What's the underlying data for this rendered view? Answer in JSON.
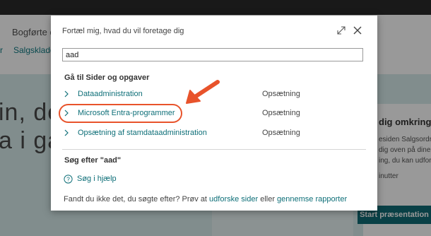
{
  "background": {
    "page_title_partial": "Bogførte do",
    "nav_partial": "Salgskladd",
    "nav_marker": "r",
    "hero_line1": "in, de",
    "hero_line2": "a i gar",
    "side_card": {
      "title": "dig omkring",
      "line1": "esiden Salgsordr",
      "line2": "dig oven på dine s",
      "line3": "ing, du kan udforsk",
      "line4": "inutter"
    },
    "start_button": "Start præsentation"
  },
  "dialog": {
    "title": "Fortæl mig, hvad du vil foretage dig",
    "search_value": "aad",
    "section_pages": "Gå til Sider og opgaver",
    "results": [
      {
        "label": "Dataadministration",
        "category": "Opsætning"
      },
      {
        "label": "Microsoft Entra-programmer",
        "category": "Opsætning"
      },
      {
        "label": "Opsætning af stamdataadministration",
        "category": "Opsætning"
      }
    ],
    "section_search": "Søg efter \"aad\"",
    "help_label": "Søg i hjælp",
    "footer_prefix": "Fandt du ikke det, du søgte efter? Prøv at ",
    "footer_link1": "udforske sider",
    "footer_mid": " eller ",
    "footer_link2": "gennemse rapporter"
  },
  "colors": {
    "accent": "#0e6f78",
    "annotation": "#e8532b"
  },
  "icons": [
    "expand-icon",
    "close-icon",
    "chevron-right-icon",
    "help-circle-icon",
    "annotation-arrow"
  ]
}
